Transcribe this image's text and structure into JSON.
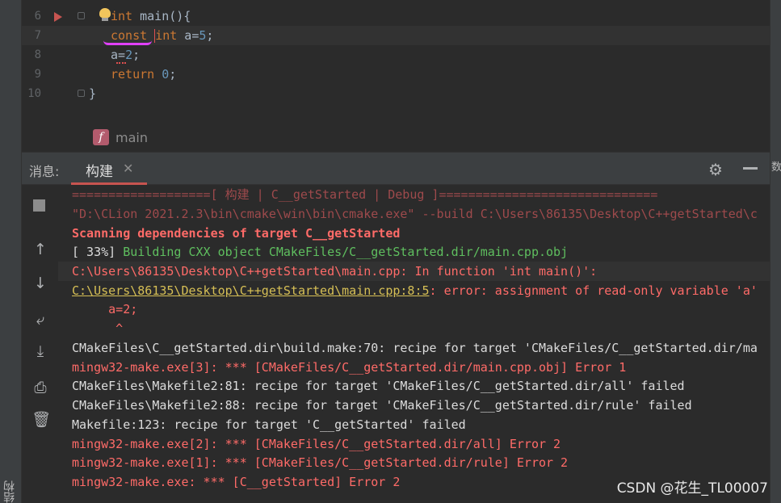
{
  "editor": {
    "lines": [
      {
        "num": "6"
      },
      {
        "num": "7"
      },
      {
        "num": "8"
      },
      {
        "num": "9"
      },
      {
        "num": "10"
      }
    ],
    "code": {
      "l6_kw": "int",
      "l6_fn": "main",
      "l6_rest": "(){",
      "l7_const": "const",
      "l7_int": "int",
      "l7_rest": " a=",
      "l7_num": "5",
      "l7_end": ";",
      "l8_a": "a",
      "l8_eq": "=",
      "l8_num": "2",
      "l8_end": ";",
      "l9_kw": "return",
      "l9_num": "0",
      "l9_end": ";",
      "l10": "}"
    },
    "breadcrumb": {
      "badge": "f",
      "text": "main"
    }
  },
  "tool_window": {
    "label": "消息:",
    "tab_label": "构建",
    "tab_close": "✕",
    "gear": "⚙",
    "left_strip_label": "结构",
    "right_strip_label": "数"
  },
  "console": {
    "lines": [
      "===================[ 构建 | C__getStarted | Debug ]==============================",
      "\"D:\\CLion 2021.2.3\\bin\\cmake\\win\\bin\\cmake.exe\" --build C:\\Users\\86135\\Desktop\\C++getStarted\\c",
      "Scanning dependencies of target C__getStarted",
      "[ 33%] ",
      "Building CXX object CMakeFiles/C__getStarted.dir/main.cpp.obj",
      "C:\\Users\\86135\\Desktop\\C++getStarted\\main.cpp: In function 'int main()':",
      "C:\\Users\\86135\\Desktop\\C++getStarted\\main.cpp:8:5",
      ": error: assignment of read-only variable 'a'",
      "     a=2;",
      "      ^",
      "CMakeFiles\\C__getStarted.dir\\build.make:70: recipe for target 'CMakeFiles/C__getStarted.dir/ma",
      "mingw32-make.exe[3]: *** [CMakeFiles/C__getStarted.dir/main.cpp.obj] Error 1",
      "CMakeFiles\\Makefile2:81: recipe for target 'CMakeFiles/C__getStarted.dir/all' failed",
      "CMakeFiles\\Makefile2:88: recipe for target 'CMakeFiles/C__getStarted.dir/rule' failed",
      "Makefile:123: recipe for target 'C__getStarted' failed",
      "mingw32-make.exe[2]: *** [CMakeFiles/C__getStarted.dir/all] Error 2",
      "mingw32-make.exe[1]: *** [CMakeFiles/C__getStarted.dir/rule] Error 2",
      "mingw32-make.exe: *** [C__getStarted] Error 2"
    ]
  },
  "watermark": "CSDN @花生_TL00007",
  "colors": {
    "background": "#2b2b2b",
    "keyword": "#cc7832",
    "number": "#6897bb",
    "error_red": "#ff6b68",
    "success_green": "#5fbf5f",
    "tab_accent": "#c75450"
  }
}
